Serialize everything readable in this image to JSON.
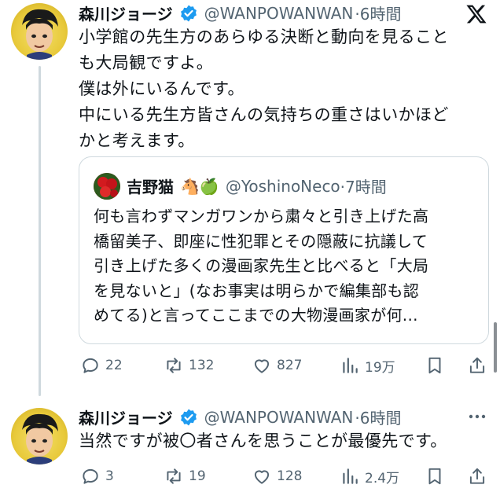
{
  "header": {
    "x_logo": "x-logo-icon"
  },
  "tweet1": {
    "display_name": "森川ジョージ",
    "handle": "@WANPOWANWAN",
    "time": "·6時間",
    "lines": [
      "小学館の先生方のあらゆる決断と動向を見ること",
      "も大局観ですよ。",
      "僕は外にいるんです。",
      "中にいる先生方皆さんの気持ちの重さはいかほど",
      "かと考えます。"
    ],
    "quote": {
      "display_name": "吉野猫",
      "emojis": "🐴🍏",
      "handle": "@YoshinoNeco",
      "time": "·7時間",
      "lines": [
        "何も言わずマンガワンから粛々と引き上げた高",
        "橋留美子、即座に性犯罪とその隠蔽に抗議して",
        "引き上げた多くの漫画家先生と比べると「大局",
        "を見ないと」(なお事実は明らかで編集部も認",
        "めてる)と言ってここまでの大物漫画家が何..."
      ]
    },
    "metrics": {
      "replies": "22",
      "reposts": "132",
      "likes": "827",
      "views": "19万"
    }
  },
  "tweet2": {
    "display_name": "森川ジョージ",
    "handle": "@WANPOWANWAN",
    "time": "·6時間",
    "text": "当然ですが被〇者さんを思うことが最優先です。",
    "metrics": {
      "replies": "3",
      "reposts": "19",
      "likes": "128",
      "views": "2.4万"
    }
  },
  "colors": {
    "text": "#0f1419",
    "muted": "#536471",
    "border": "#cfd9de",
    "verified": "#1d9bf0"
  }
}
